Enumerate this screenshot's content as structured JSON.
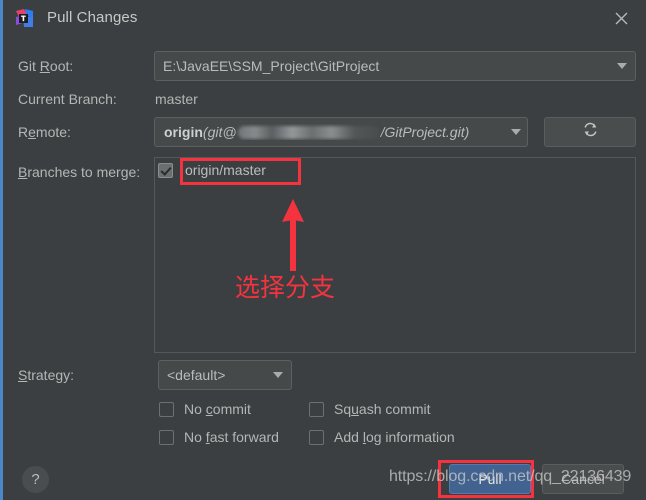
{
  "window": {
    "title": "Pull Changes",
    "app_icon": "intellij-idea-icon",
    "close_icon": "close-icon",
    "accent_color": "#4a88c7",
    "background_color": "#3c3f41"
  },
  "form": {
    "git_root": {
      "label": "Git Root:",
      "label_mnemonic": "R",
      "value": "E:\\JavaEE\\SSM_Project\\GitProject"
    },
    "current_branch": {
      "label": "Current Branch:",
      "value": "master"
    },
    "remote": {
      "label": "Remote:",
      "label_mnemonic": "R",
      "origin": "origin",
      "open_paren": "(",
      "prefix": "git@",
      "suffix": "/GitProject.git",
      "close_paren": ")",
      "blurred": true
    },
    "refresh_button": {
      "icon": "refresh-icon",
      "label": ""
    },
    "branches": {
      "label": "Branches to merge:",
      "label_mnemonic": "B",
      "items": [
        {
          "name": "origin/master",
          "checked": true
        }
      ]
    },
    "strategy": {
      "label": "Strategy:",
      "label_mnemonic": "S",
      "value": "<default>"
    },
    "options": [
      {
        "id": "no-commit",
        "pre": "No ",
        "mnemonic": "c",
        "post": "ommit",
        "checked": false
      },
      {
        "id": "no-fast-forward",
        "pre": "No ",
        "mnemonic": "f",
        "post": "ast forward",
        "checked": false
      },
      {
        "id": "squash-commit",
        "pre": "Sq",
        "mnemonic": "u",
        "post": "ash commit",
        "checked": false
      },
      {
        "id": "add-log-information",
        "pre": "Add ",
        "mnemonic": "l",
        "post": "og information",
        "checked": false
      }
    ]
  },
  "footer": {
    "help_label": "?",
    "pull_label": "Pull",
    "cancel_label": "Cancel"
  },
  "annotations": {
    "branch_note": "选择分支",
    "highlight_color": "#f5333f",
    "watermark": "https://blog.csdn.net/qq_22136439"
  }
}
